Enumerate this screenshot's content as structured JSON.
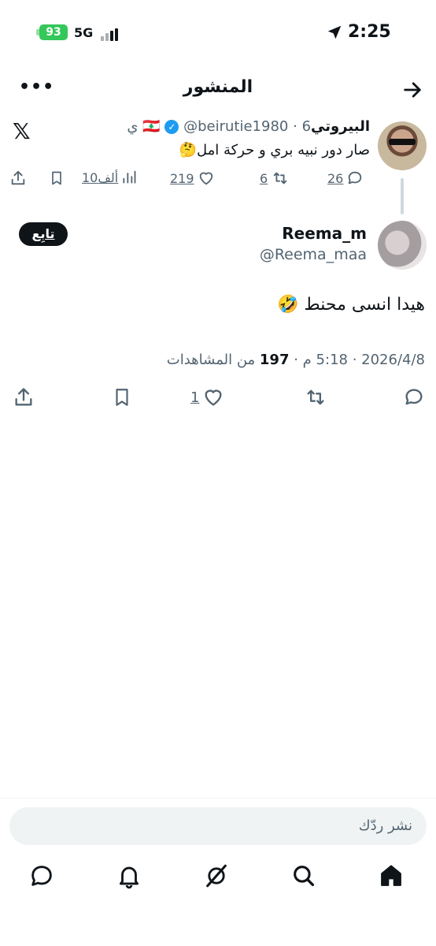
{
  "status_bar": {
    "time": "2:25",
    "battery": "93",
    "network": "5G"
  },
  "header": {
    "title": "المنشور"
  },
  "parent_post": {
    "name": "البيروتي🇱🇧",
    "handle": "@beirutie1980",
    "age": "6 ي",
    "text": "صار دور نبيه بري و حركة امل🤔",
    "replies": "26",
    "reposts": "6",
    "likes": "219",
    "views": "10ألف"
  },
  "main_post": {
    "name": "Reema_m",
    "handle": "@Reema_maa",
    "follow_label": "تابِع",
    "text": "هيدا انسى محنط 🤣",
    "date": "2026/4/8",
    "time": "5:18 م",
    "views_count": "197",
    "views_label": "من المشاهدات",
    "likes": "1"
  },
  "composer": {
    "placeholder": "نشر ردّك"
  },
  "icons": {
    "back": "arrow-right-icon",
    "more": "more-icon",
    "x_logo": "x-logo-icon",
    "verified": "verified-badge-icon"
  },
  "colors": {
    "accent": "#1d9bf0",
    "battery": "#34c759",
    "text_secondary": "#536471"
  }
}
